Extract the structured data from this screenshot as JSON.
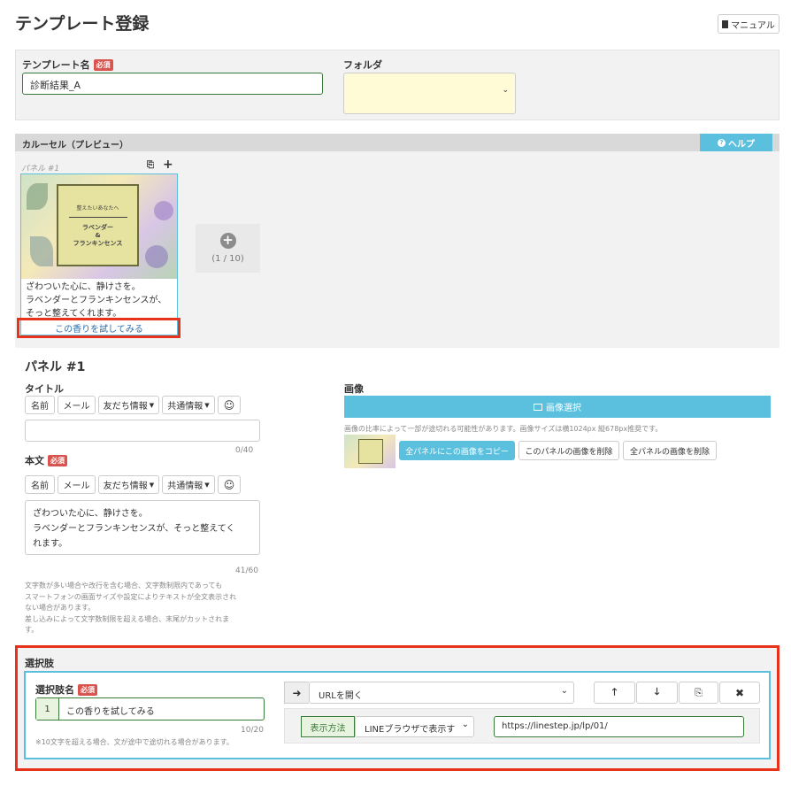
{
  "page": {
    "title": "テンプレート登録",
    "manual": "マニュアル"
  },
  "template_name": {
    "label": "テンプレート名",
    "required": "必須",
    "value": "診断結果_A"
  },
  "folder": {
    "label": "フォルダ"
  },
  "carousel": {
    "header": "カルーセル（プレビュー）",
    "help": "ヘルプ",
    "panel_label": "パネル #1",
    "image_line1": "整えたいあなたへ",
    "image_line2": "ラベンダー",
    "image_line3": "&",
    "image_line4": "フランキンセンス",
    "text1": "ざわついた心に、静けさを。",
    "text2": "ラベンダーとフランキンセンスが、",
    "text3": "そっと整えてくれます。",
    "action": "この香りを試してみる",
    "counter": "(1 / 10)"
  },
  "panel": {
    "title": "パネル #1",
    "title_field": {
      "label": "タイトル",
      "counter": "0/40"
    },
    "body_field": {
      "label": "本文",
      "required": "必須",
      "line1": "ざわついた心に、静けさを。",
      "line2": "ラベンダーとフランキンセンスが、そっと整えてく",
      "line3": "れます。",
      "counter": "41/60"
    },
    "tokens": {
      "name": "名前",
      "mail": "メール",
      "friend": "友だち情報",
      "common": "共通情報"
    },
    "note": [
      "文字数が多い場合や改行を含む場合、文字数制限内であっても",
      "スマートフォンの画面サイズや設定によりテキストが全文表示され",
      "ない場合があります。",
      "差し込みによって文字数制限を超える場合、末尾がカットされま",
      "す。"
    ]
  },
  "image": {
    "label": "画像",
    "select": "画像選択",
    "note": "画像の比率によって一部が途切れる可能性があります。画像サイズは横1024px 縦678px推奨です。",
    "copy_all": "全パネルにこの画像をコピー",
    "delete_this": "このパネルの画像を削除",
    "delete_all": "全パネルの画像を削除"
  },
  "choices": {
    "section": "選択肢",
    "label": "選択肢名",
    "required": "必須",
    "index": "1",
    "value": "この香りを試してみる",
    "counter": "10/20",
    "note": "※10文字を超える場合、文が途中で途切れる場合があります。",
    "action_value": "URLを開く",
    "display_label": "表示方法",
    "display_value": "LINEブラウザで表示す",
    "url": "https://linestep.jp/lp/01/"
  },
  "colors": {
    "accent": "#5bc0de",
    "required": "#d9534f",
    "highlight": "#e8331c",
    "field_green": "#3a7a3a",
    "folder_bg": "#fffbd6"
  }
}
